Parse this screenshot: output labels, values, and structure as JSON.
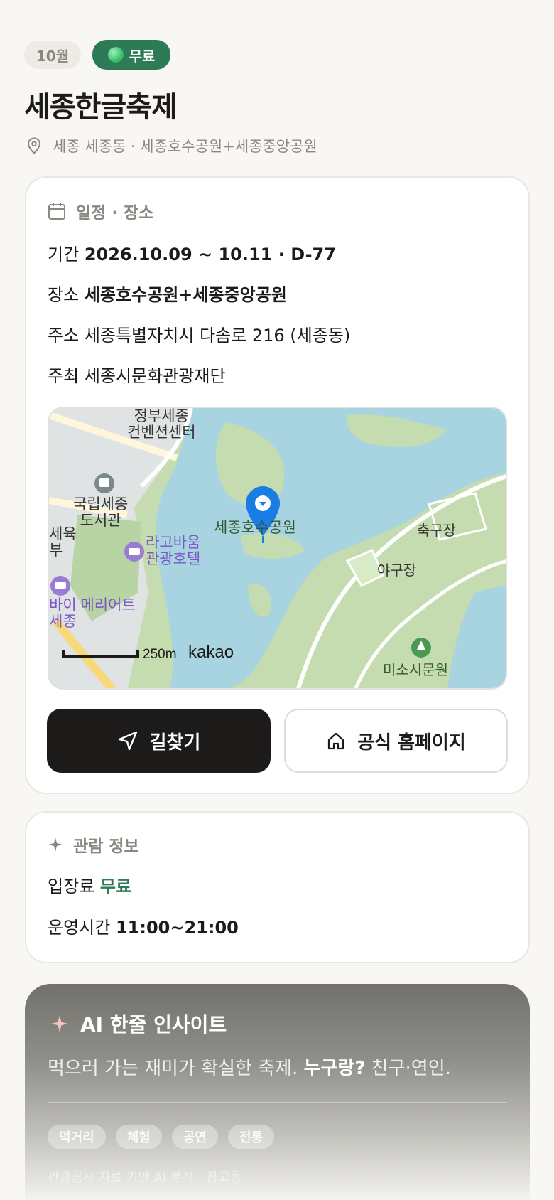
{
  "header": {
    "month_chip": "10월",
    "price_chip": "무료",
    "title": "세종한글축제",
    "location": "세종 세종동 · 세종호수공원+세종중앙공원"
  },
  "schedule": {
    "heading": "일정 · 장소",
    "period_label": "기간",
    "period_value": "2026.10.09 ~ 10.11 · D-77",
    "venue_label": "장소",
    "venue_value": "세종호수공원+세종중앙공원",
    "address_label": "주소",
    "address_value": "세종특별자치시 다솜로 216 (세종동)",
    "host_label": "주최",
    "host_value": "세종시문화관광재단"
  },
  "map": {
    "labels": {
      "convention": "정부세종\n컨벤션센터",
      "library": "국립세종\n도서관",
      "hotel": "라고바움\n관광호텔",
      "marriott": "바이 메리어트\n세종",
      "left_edge": "세육\n부",
      "park": "세종호수공원",
      "football": "축구장",
      "baseball": "야구장",
      "arboretum": "미소시문원"
    },
    "scale": "250m",
    "brand": "kakao"
  },
  "actions": {
    "directions": "길찾기",
    "homepage": "공식 홈페이지"
  },
  "visit": {
    "heading": "관람 정보",
    "fee_label": "입장료",
    "fee_value": "무료",
    "hours_label": "운영시간",
    "hours_value": "11:00~21:00"
  },
  "ai": {
    "heading": "AI 한줄 인사이트",
    "text_prefix": "먹으러 가는 재미가 확실한 축제.",
    "text_bold": "누구랑?",
    "text_suffix": "친구·연인.",
    "tags": [
      "먹거리",
      "체험",
      "공연",
      "전통"
    ],
    "footnote": "관광공사 자료 기반 AI 분석 · 참고용"
  },
  "colors": {
    "accent_green": "#2d7a57",
    "dark_button": "#1c1b19",
    "map_water": "#a8d3e0",
    "map_land": "#c4dcb0",
    "pin_blue": "#1a7de6"
  }
}
